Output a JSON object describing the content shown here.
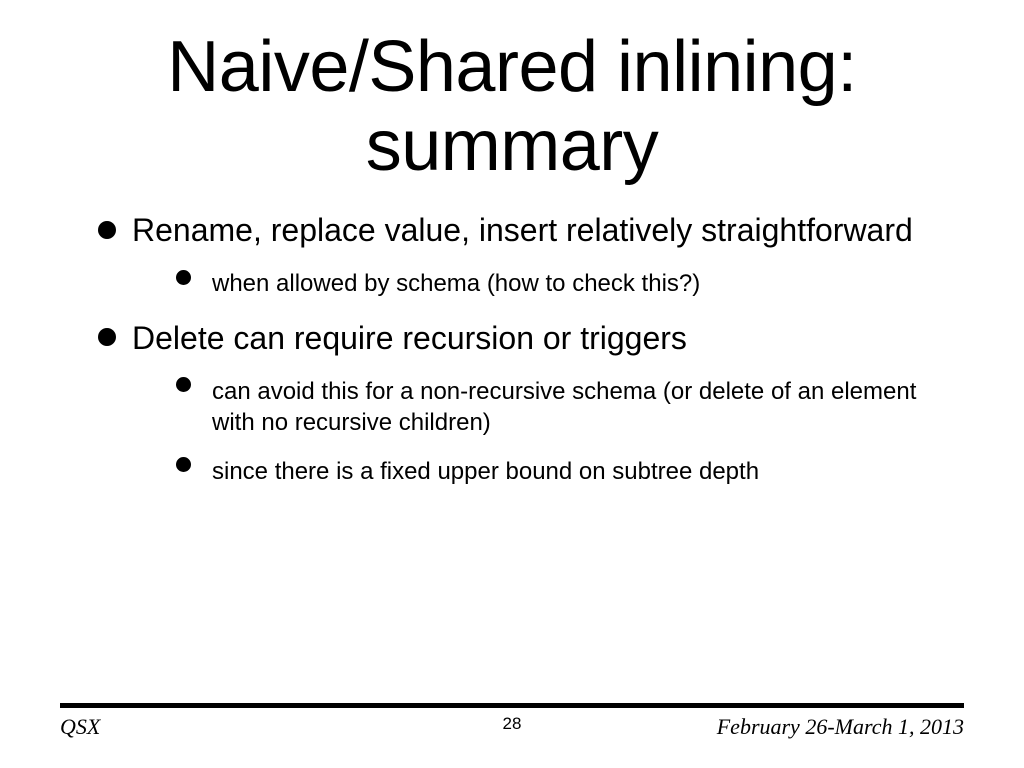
{
  "title": "Naive/Shared inlining: summary",
  "bullets": [
    {
      "text": "Rename, replace value, insert relatively straightforward",
      "sub": [
        {
          "text": "when allowed by schema (how to check this?)"
        }
      ]
    },
    {
      "text": "Delete can require recursion or triggers",
      "sub": [
        {
          "text": "can avoid this for a non-recursive schema (or delete of an element with no recursive children)"
        },
        {
          "text": "since there is a fixed upper bound on subtree depth"
        }
      ]
    }
  ],
  "footer": {
    "left": "QSX",
    "right": "February 26-March 1, 2013",
    "page": "28"
  }
}
